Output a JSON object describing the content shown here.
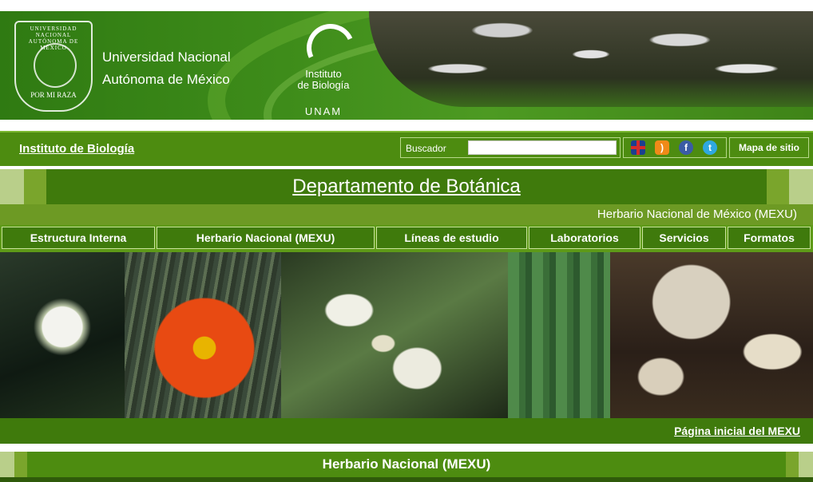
{
  "header": {
    "university_line1": "Universidad Nacional",
    "university_line2": "Autónoma de México",
    "seal_top_text": "UNIVERSIDAD NACIONAL AUTÓNOMA DE MÉXICO",
    "seal_motto": "POR MI RAZA",
    "ib_logo_line1": "Instituto",
    "ib_logo_line2": "de Biología",
    "ib_logo_unam": "UNAM"
  },
  "topbar": {
    "institute_link": "Instituto de Biología",
    "search_label": "Buscador",
    "search_value": "",
    "icons": [
      "uk-flag-icon",
      "rss-icon",
      "facebook-icon",
      "twitter-icon"
    ],
    "sitemap_label": "Mapa de sitio"
  },
  "department": {
    "title": "Departamento de Botánica",
    "subtitle": "Herbario Nacional de México (MEXU)"
  },
  "menu": {
    "items": [
      {
        "label": "Estructura Interna"
      },
      {
        "label": "Herbario Nacional (MEXU)"
      },
      {
        "label": "Líneas de estudio"
      },
      {
        "label": "Laboratorios"
      },
      {
        "label": "Servicios"
      },
      {
        "label": "Formatos"
      }
    ]
  },
  "home_link": "Página inicial del MEXU",
  "section_title": "Herbario Nacional (MEXU)",
  "colors": {
    "dark_green": "#3f7a0c",
    "mid_green": "#4d8c10",
    "light_green": "#b9cf8a"
  }
}
